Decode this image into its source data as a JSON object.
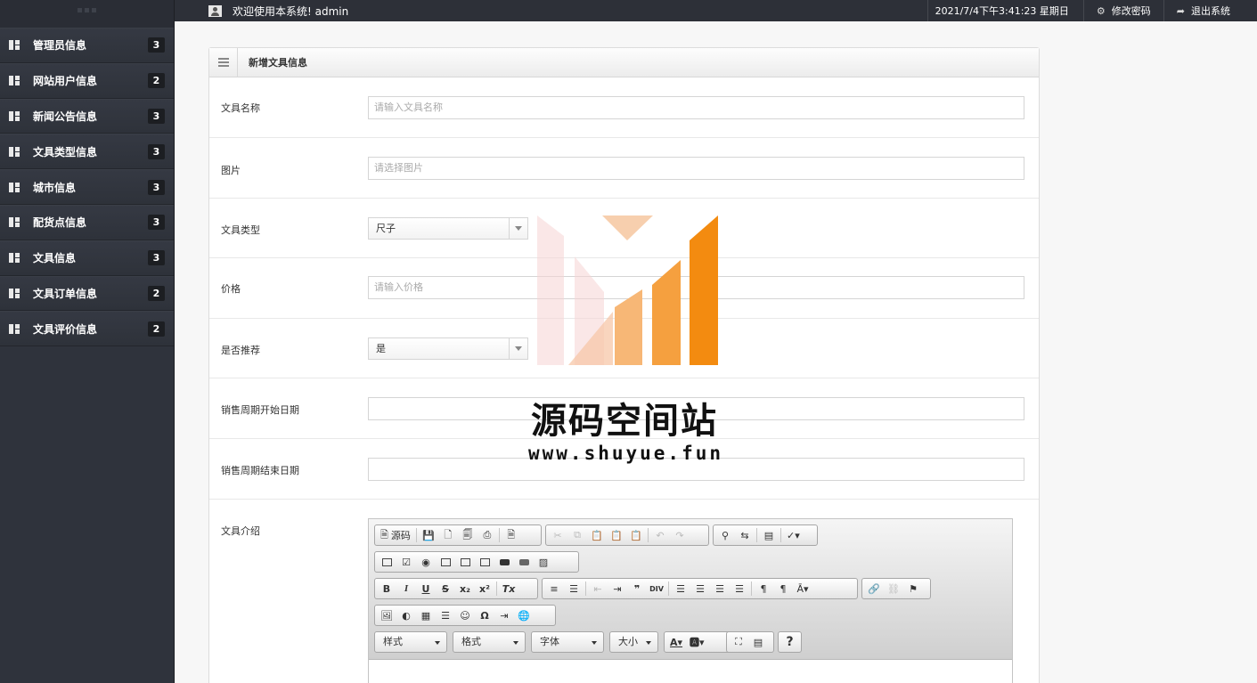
{
  "topbar": {
    "welcome": "欢迎使用本系统! admin",
    "datetime": "2021/7/4下午3:41:23 星期日",
    "change_password": "修改密码",
    "logout": "退出系统"
  },
  "sidebar": {
    "items": [
      {
        "label": "管理员信息",
        "count": "3"
      },
      {
        "label": "网站用户信息",
        "count": "2"
      },
      {
        "label": "新闻公告信息",
        "count": "3"
      },
      {
        "label": "文具类型信息",
        "count": "3"
      },
      {
        "label": "城市信息",
        "count": "3"
      },
      {
        "label": "配货点信息",
        "count": "3"
      },
      {
        "label": "文具信息",
        "count": "3"
      },
      {
        "label": "文具订单信息",
        "count": "2"
      },
      {
        "label": "文具评价信息",
        "count": "2"
      }
    ]
  },
  "panel": {
    "title": "新增文具信息"
  },
  "form": {
    "name_label": "文具名称",
    "name_placeholder": "请输入文具名称",
    "image_label": "图片",
    "image_placeholder": "请选择图片",
    "type_label": "文具类型",
    "type_value": "尺子",
    "price_label": "价格",
    "price_placeholder": "请输入价格",
    "recommend_label": "是否推荐",
    "recommend_value": "是",
    "start_label": "销售周期开始日期",
    "end_label": "销售周期结束日期",
    "intro_label": "文具介绍"
  },
  "editor": {
    "source": "源码",
    "style": "样式",
    "format": "格式",
    "font": "字体",
    "size": "大小",
    "help": "?"
  },
  "watermark": {
    "title": "源码空间站",
    "url": "www.shuyue.fun"
  }
}
